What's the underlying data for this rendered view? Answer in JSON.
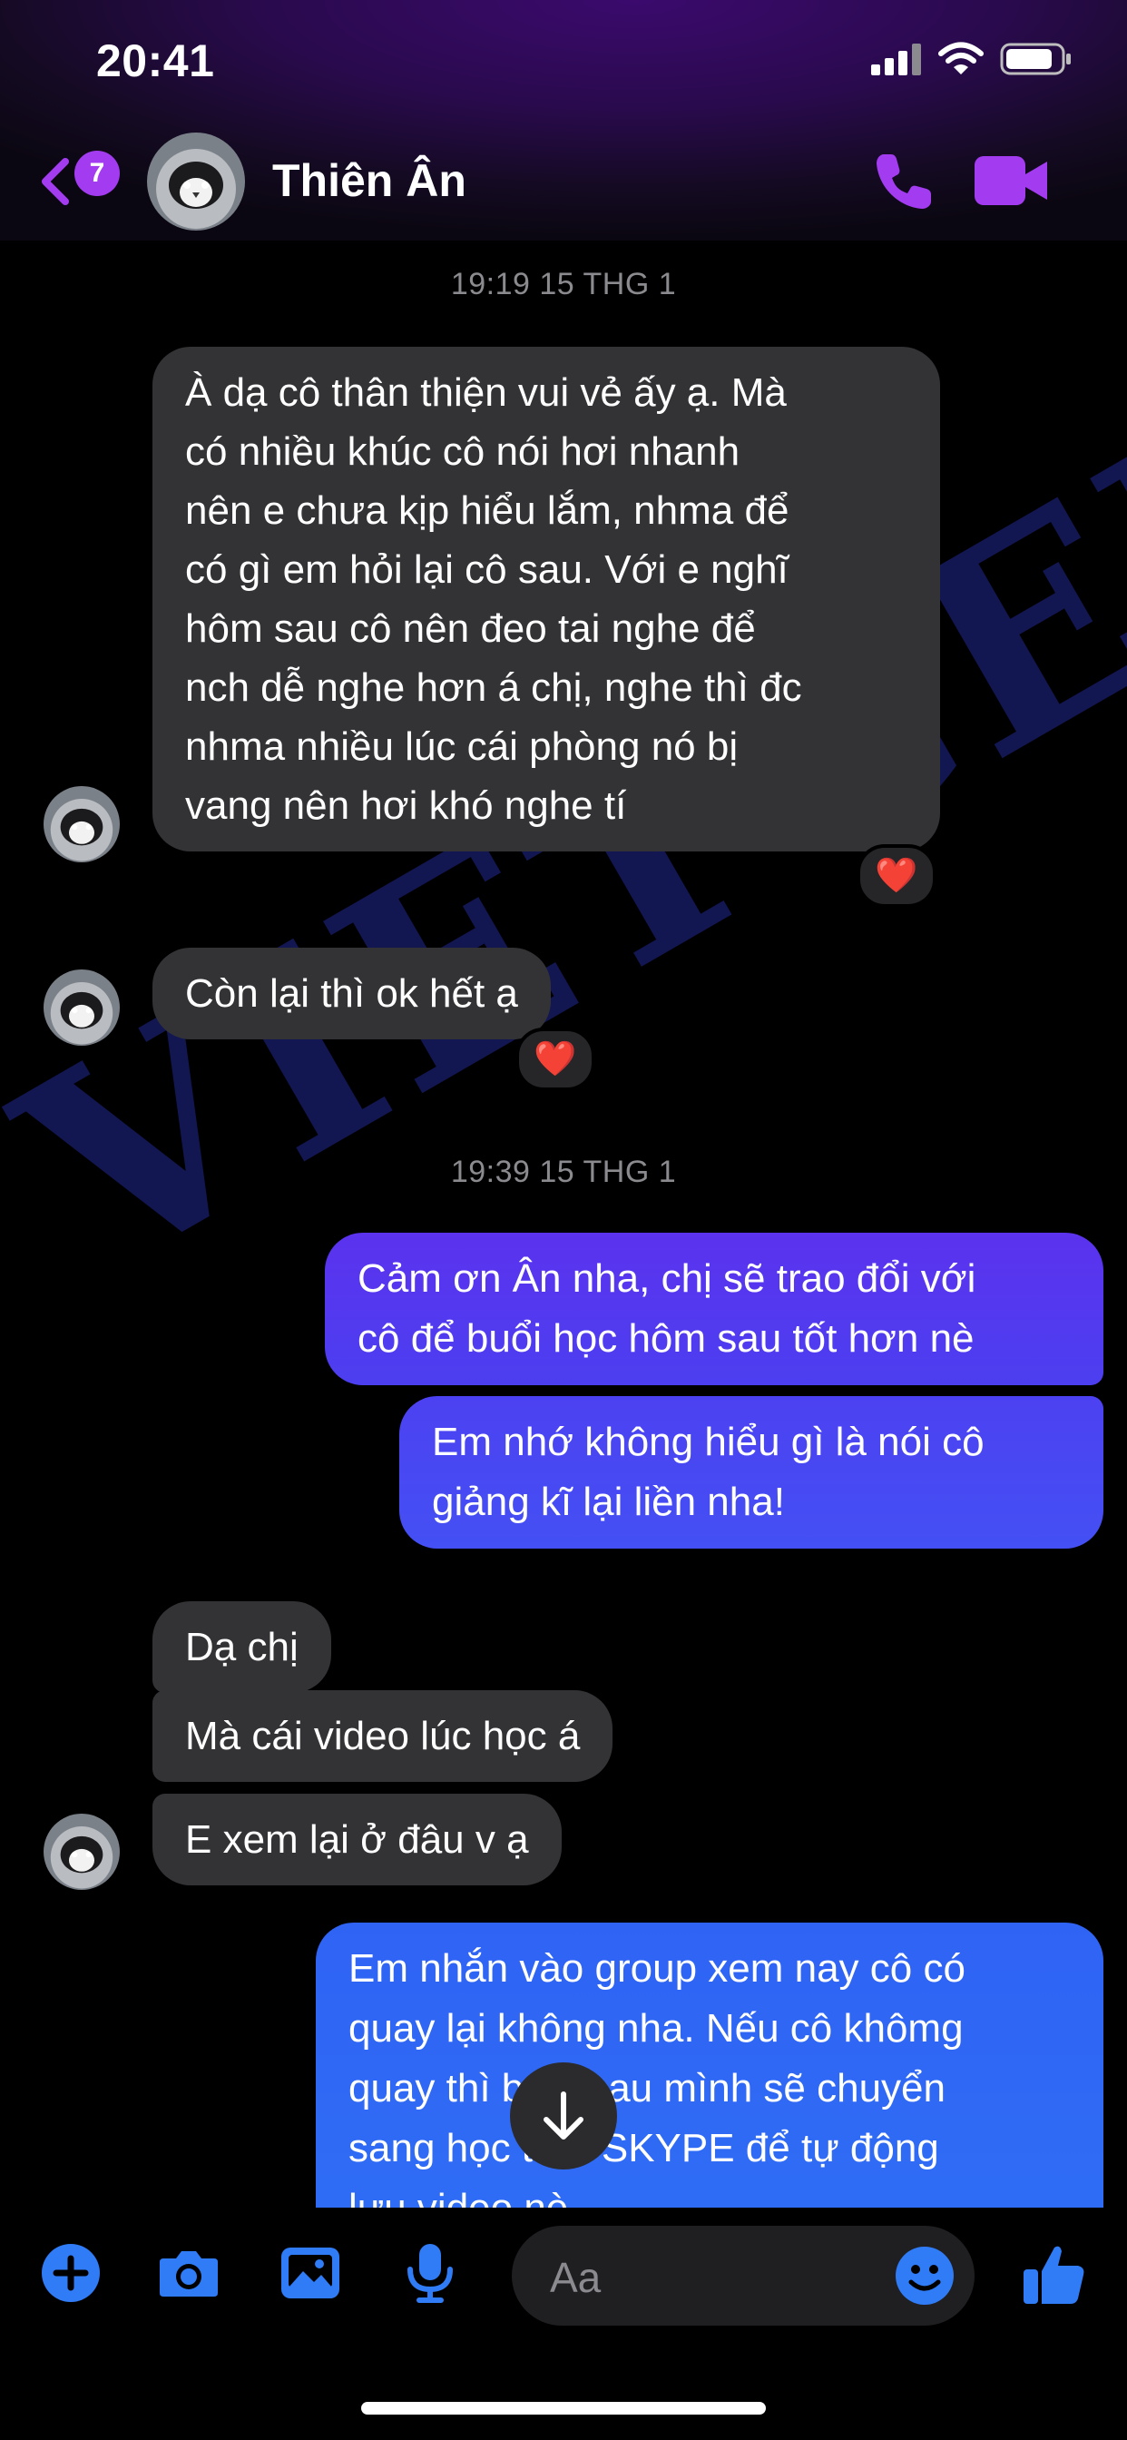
{
  "status_bar": {
    "time": "20:41"
  },
  "header": {
    "unread_count": "7",
    "contact_name": "Thiên Ân",
    "icons": [
      "back-chevron-icon",
      "phone-icon",
      "video-camera-icon"
    ],
    "accent_color": "#a33cf0"
  },
  "conversation": {
    "timestamps": [
      "19:19 15 THG 1",
      "19:39 15 THG 1"
    ],
    "incoming_1_lines": [
      "À dạ cô thân thiện vui vẻ ấy ạ. Mà",
      "có nhiều khúc cô nói hơi nhanh",
      "nên e chưa kịp hiểu lắm, nhma để",
      "có gì em hỏi lại cô sau. Với e nghĩ",
      "hôm sau cô nên đeo tai nghe để",
      "nch dễ nghe hơn á chị, nghe thì đc",
      "nhma nhiều lúc cái phòng nó bị",
      "vang nên hơi khó nghe tí"
    ],
    "incoming_2": "Còn lại thì ok hết ạ",
    "outgoing_1_lines": [
      "Cảm ơn Ân nha, chị sẽ trao đổi với",
      "cô để buổi học hôm sau tốt hơn nè"
    ],
    "outgoing_2_lines": [
      "Em nhớ không hiểu gì là nói cô",
      "giảng kĩ lại liền nha!"
    ],
    "incoming_3": "Dạ chị",
    "incoming_4": "Mà cái video lúc học á",
    "incoming_5": "E xem lại ở đâu v ạ",
    "outgoing_3_lines": [
      "Em nhắn vào group xem nay cô có",
      "quay lại không nha. Nếu cô khômg",
      "quay thì buổi sau mình sẽ chuyển",
      "sang học trên SKYPE để tự động",
      "lưu video nè"
    ],
    "reaction": "❤️",
    "bubble_colors": {
      "incoming": "#333336",
      "outgoing_top": "#4b3cf0",
      "outgoing_bottom": "#2f6ef5"
    }
  },
  "watermark": {
    "text": "VIETGEN"
  },
  "composer": {
    "placeholder": "Aa",
    "icons": [
      "plus-icon",
      "camera-icon",
      "photo-icon",
      "microphone-icon",
      "emoji-icon",
      "thumbs-up-icon"
    ],
    "icon_color": "#2f7cf6"
  }
}
